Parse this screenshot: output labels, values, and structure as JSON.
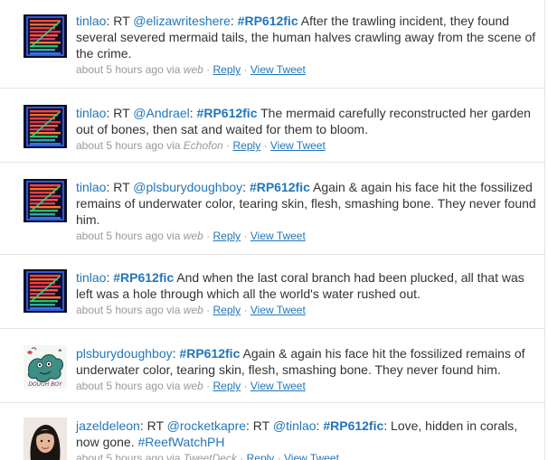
{
  "tweets": [
    {
      "avatar": "tinlao-avatar",
      "parts": [
        {
          "t": "user",
          "v": "tinlao"
        },
        {
          "t": "text",
          "v": ": RT "
        },
        {
          "t": "mention",
          "v": "@elizawriteshere"
        },
        {
          "t": "text",
          "v": ": "
        },
        {
          "t": "hashtag",
          "v": "#RP612fic"
        },
        {
          "t": "text",
          "v": " After the trawling incident, they found several severed mermaid tails, the human halves crawling away from the scene of the crime."
        }
      ],
      "time": "about 5 hours ago",
      "via": "via",
      "source": "web",
      "reply": "Reply",
      "view": "View Tweet"
    },
    {
      "avatar": "tinlao-avatar",
      "parts": [
        {
          "t": "user",
          "v": "tinlao"
        },
        {
          "t": "text",
          "v": ": RT "
        },
        {
          "t": "mention",
          "v": "@Andrael"
        },
        {
          "t": "text",
          "v": ": "
        },
        {
          "t": "hashtag",
          "v": "#RP612fic"
        },
        {
          "t": "text",
          "v": " The mermaid carefully reconstructed her garden out of bones, then sat and waited for them to bloom."
        }
      ],
      "time": "about 5 hours ago",
      "via": "via",
      "source": "Echofon",
      "reply": "Reply",
      "view": "View Tweet"
    },
    {
      "avatar": "tinlao-avatar",
      "parts": [
        {
          "t": "user",
          "v": "tinlao"
        },
        {
          "t": "text",
          "v": ": RT "
        },
        {
          "t": "mention",
          "v": "@plsburydoughboy"
        },
        {
          "t": "text",
          "v": ": "
        },
        {
          "t": "hashtag",
          "v": "#RP612fic"
        },
        {
          "t": "text",
          "v": " Again & again his face hit the fossilized remains of underwater color, tearing skin, flesh, smashing bone. They never found him."
        }
      ],
      "time": "about 5 hours ago",
      "via": "via",
      "source": "web",
      "reply": "Reply",
      "view": "View Tweet"
    },
    {
      "avatar": "tinlao-avatar",
      "parts": [
        {
          "t": "user",
          "v": "tinlao"
        },
        {
          "t": "text",
          "v": ": "
        },
        {
          "t": "hashtag",
          "v": "#RP612fic"
        },
        {
          "t": "text",
          "v": " And when the last coral branch had been plucked, all that was left was a hole through which all the world's water rushed out."
        }
      ],
      "time": "about 5 hours ago",
      "via": "via",
      "source": "web",
      "reply": "Reply",
      "view": "View Tweet"
    },
    {
      "avatar": "doughboy-avatar",
      "avatar_text": "DOUGH BOY",
      "parts": [
        {
          "t": "user",
          "v": "plsburydoughboy"
        },
        {
          "t": "text",
          "v": ": "
        },
        {
          "t": "hashtag",
          "v": "#RP612fic"
        },
        {
          "t": "text",
          "v": " Again & again his face hit the fossilized remains of underwater color, tearing skin, flesh, smashing bone. They never found him."
        }
      ],
      "time": "about 5 hours ago",
      "via": "via",
      "source": "web",
      "reply": "Reply",
      "view": "View Tweet"
    },
    {
      "avatar": "jazel-avatar",
      "parts": [
        {
          "t": "user",
          "v": "jazeldeleon"
        },
        {
          "t": "text",
          "v": ": RT "
        },
        {
          "t": "mention",
          "v": "@rocketkapre"
        },
        {
          "t": "text",
          "v": ": RT "
        },
        {
          "t": "mention",
          "v": "@tinlao"
        },
        {
          "t": "text",
          "v": ": "
        },
        {
          "t": "hashtag",
          "v": "#RP612fic"
        },
        {
          "t": "text",
          "v": ": Love, hidden in corals, now gone. "
        },
        {
          "t": "hashtag-plain",
          "v": "#ReefWatchPH"
        }
      ],
      "time": "about 5 hours ago",
      "via": "via",
      "source": "TweetDeck",
      "reply": "Reply",
      "view": "View Tweet"
    }
  ]
}
